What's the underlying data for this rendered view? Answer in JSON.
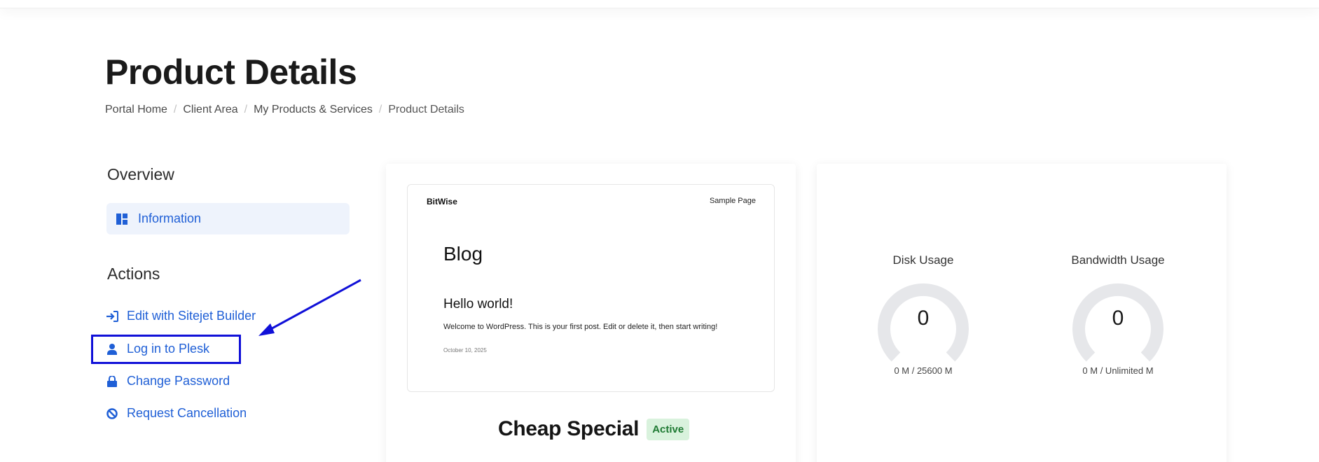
{
  "page": {
    "title": "Product Details"
  },
  "breadcrumb": [
    {
      "label": "Portal Home"
    },
    {
      "label": "Client Area"
    },
    {
      "label": "My Products & Services"
    },
    {
      "label": "Product Details"
    }
  ],
  "sidebar": {
    "overview_title": "Overview",
    "information_label": "Information",
    "actions_title": "Actions",
    "actions": [
      {
        "label": "Edit with Sitejet Builder",
        "icon": "sign-in-icon"
      },
      {
        "label": "Log in to Plesk",
        "icon": "user-icon"
      },
      {
        "label": "Change Password",
        "icon": "lock-icon"
      },
      {
        "label": "Request Cancellation",
        "icon": "ban-icon"
      }
    ]
  },
  "preview": {
    "brand": "BitWise",
    "nav_link": "Sample Page",
    "heading": "Blog",
    "post_title": "Hello world!",
    "post_excerpt": "Welcome to WordPress. This is your first post. Edit or delete it, then start writing!",
    "post_date": "October 10, 2025"
  },
  "product": {
    "name": "Cheap Special",
    "status": "Active"
  },
  "usage": {
    "disk": {
      "label": "Disk Usage",
      "value": "0",
      "amount": "0 M / 25600 M"
    },
    "bandwidth": {
      "label": "Bandwidth Usage",
      "value": "0",
      "amount": "0 M / Unlimited M"
    }
  },
  "colors": {
    "link": "#1f5fd6",
    "highlight": "#1010d8",
    "badge_bg": "#d9f2dd",
    "badge_text": "#1f7a33",
    "gauge_track": "#e6e7ea"
  }
}
